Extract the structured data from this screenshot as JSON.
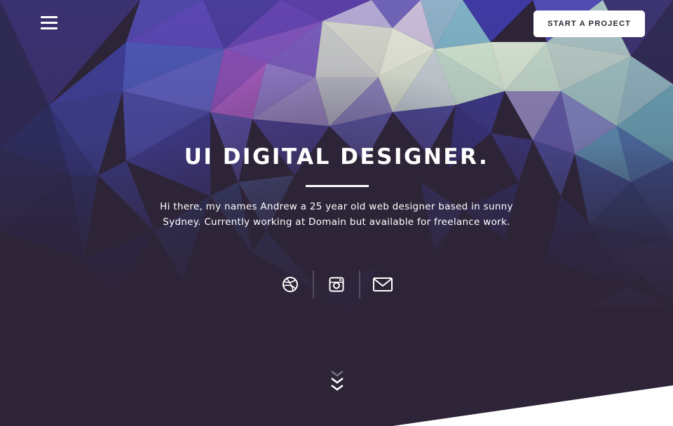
{
  "header": {
    "menu_icon": "hamburger-menu-icon",
    "cta_label": "START A PROJECT"
  },
  "hero": {
    "title": "UI DIGITAL DESIGNER.",
    "intro": "Hi there, my names Andrew a 25 year old web designer based in sunny Sydney. Currently working at Domain but available for freelance work."
  },
  "social": [
    {
      "icon": "dribbble-icon"
    },
    {
      "icon": "instagram-icon"
    },
    {
      "icon": "email-icon"
    }
  ],
  "scroll": {
    "icon": "double-chevron-down-icon"
  },
  "colors": {
    "background": "#2e2438",
    "accent_purple": "#6a4fc8",
    "accent_mint": "#cfe3cf",
    "text": "#ffffff"
  }
}
